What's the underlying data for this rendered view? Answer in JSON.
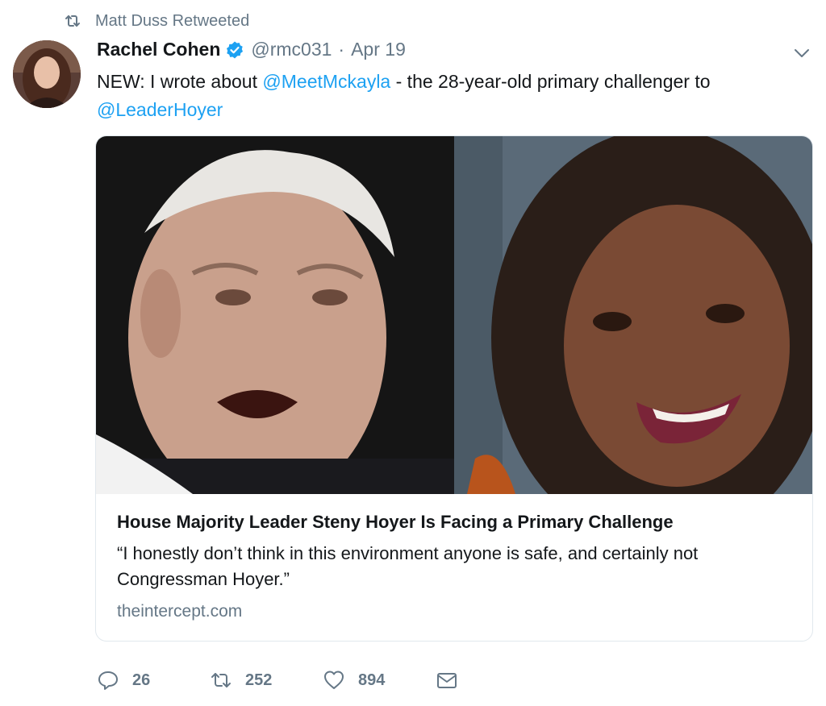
{
  "retweet_context": {
    "text": "Matt Duss Retweeted",
    "icon": "retweet-icon"
  },
  "author": {
    "fullname": "Rachel Cohen",
    "verified_icon": "verified-badge-icon",
    "username": "@rmc031",
    "separator": "·",
    "timestamp": "Apr 19"
  },
  "tweet": {
    "text_part1": "NEW: I wrote about ",
    "mention1": "@MeetMckayla",
    "text_part2": " - the 28-year-old primary challenger to ",
    "mention2": "@LeaderHoyer"
  },
  "card": {
    "title": "House Majority Leader Steny Hoyer Is Facing a Primary Challenge",
    "description": "“I honestly don’t think in this environment anyone is safe, and certainly not Congressman Hoyer.”",
    "domain": "theintercept.com"
  },
  "actions": {
    "reply_count": "26",
    "retweet_count": "252",
    "like_count": "894"
  },
  "colors": {
    "link": "#1da1f2",
    "secondary_text": "#657786",
    "primary_text": "#14171a",
    "border": "#e1e8ed"
  }
}
